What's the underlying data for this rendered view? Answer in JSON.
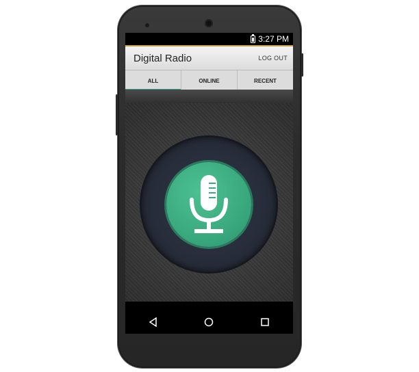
{
  "status_bar": {
    "time": "3:27 PM",
    "battery_icon": "battery-charging-icon"
  },
  "action_bar": {
    "title": "Digital Radio",
    "logout_label": "LOG OUT"
  },
  "tabs": [
    {
      "label": "ALL",
      "active": true
    },
    {
      "label": "ONLINE",
      "active": false
    },
    {
      "label": "RECENT",
      "active": false
    }
  ],
  "main": {
    "mic_icon": "microphone-icon",
    "accent_color": "#3aa97e"
  },
  "nav": {
    "back_icon": "back-triangle-icon",
    "home_icon": "home-circle-icon",
    "recents_icon": "recents-square-icon"
  }
}
